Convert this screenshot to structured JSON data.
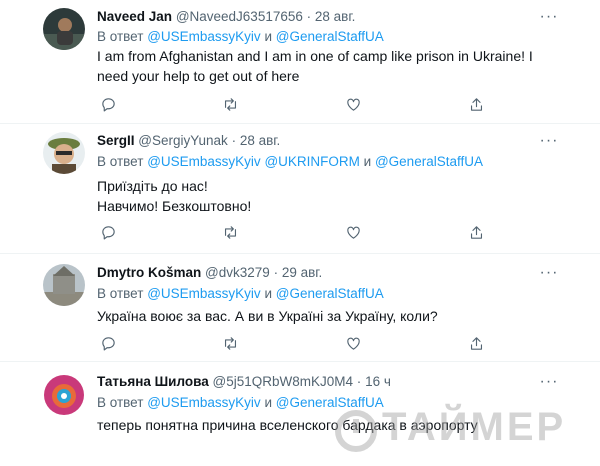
{
  "colors": {
    "link": "#1d9bf0",
    "muted": "#536471",
    "text": "#0f1419"
  },
  "reply_prefix": "В ответ",
  "conjunction": "и",
  "more_icon": "more-horizontal-icon",
  "action_icons": [
    "reply-icon",
    "retweet-icon",
    "like-icon",
    "share-icon"
  ],
  "tweets": [
    {
      "name": "Naveed Jan",
      "handle": "@NaveedJ63517656",
      "separator": "·",
      "date": "28 авг.",
      "mentions": [
        "@USEmbassyKyiv",
        "@GeneralStaffUA"
      ],
      "text": "I am from Afghanistan and I am in one of camp like prison in Ukraine! I need your help to get out of here"
    },
    {
      "name": "SergII",
      "handle": "@SergiyYunak",
      "separator": "·",
      "date": "28 авг.",
      "mentions": [
        "@USEmbassyKyiv",
        "@UKRINFORM",
        "@GeneralStaffUA"
      ],
      "text_lines": [
        "Приїздіть до нас!",
        "Навчимо! Безкоштовно!"
      ]
    },
    {
      "name": "Dmytro Košman",
      "handle": "@dvk3279",
      "separator": "·",
      "date": "29 авг.",
      "mentions": [
        "@USEmbassyKyiv",
        "@GeneralStaffUA"
      ],
      "text": "Україна воює за вас. А ви в Україні за Україну, коли?"
    },
    {
      "name": "Татьяна Шилова",
      "handle": "@5j51QRbW8mKJ0M4",
      "separator": "·",
      "date": "16 ч",
      "mentions": [
        "@USEmbassyKyiv",
        "@GeneralStaffUA"
      ],
      "text": "теперь понятна причина вселенского бардака в аэропорту"
    }
  ],
  "watermark": {
    "text": "ТАЙМЕР"
  }
}
